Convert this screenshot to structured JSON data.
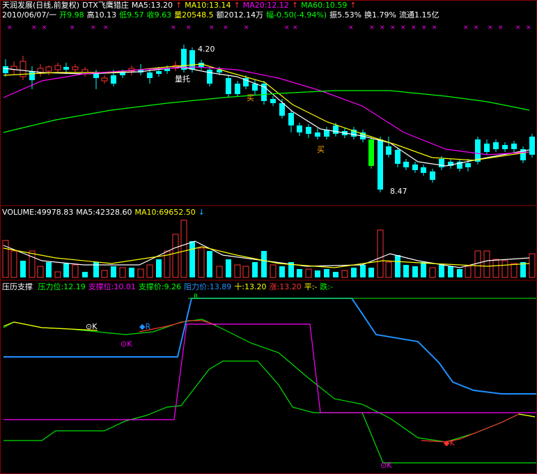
{
  "header": {
    "title": "天润发展(日线,前复权)",
    "indicator": "DTX飞鹰猎庄",
    "ma5": "MA5:13.20",
    "ma10": "MA10:13.14",
    "ma20": "MA20:12.12",
    "ma60": "MA60:10.59",
    "arrow": "↑"
  },
  "quote": {
    "date": "2010/06/07/一",
    "open": "开9.98",
    "high": "高10.13",
    "low": "低9.57",
    "close": "收9.63",
    "volume": "量20548.5",
    "amount": "额2012.14万",
    "change": "幅-0.50(-4.94%)",
    "amplitude": "振5.53%",
    "turnover": "换1.79%",
    "float": "流通1.15亿"
  },
  "price_annotations": {
    "high_label": "4.20",
    "low_label": "8.47",
    "volume_support": "量托",
    "buy1": "买",
    "buy2": "买"
  },
  "volume_panel": {
    "volume": "VOLUME:49978.83",
    "ma5": "MA5:42328.60",
    "ma10": "MA10:69652.50",
    "arrow": "↓"
  },
  "pressure_panel": {
    "title": "压历支撑",
    "pressure": "压力位:12.19",
    "support": "支撑位:10.01",
    "support_price": "支撑价:9.26",
    "resistance_price": "阻力价:13.89",
    "ten": "十:13.20",
    "up": "涨:13.20",
    "flat": "平:-",
    "down": "跌:-",
    "marker_k1": "K",
    "marker_r": "R",
    "marker_k2": "K",
    "marker_k3": "K",
    "marker_k4": "K",
    "marker_top": "R"
  },
  "colors": {
    "up_candle": "#ff3232",
    "down_candle": "#00ffff",
    "ma5": "#ffffff",
    "ma10": "#ffff00",
    "ma20": "#ff00ff",
    "ma60": "#00ff00",
    "grid": "#8b0000",
    "pressure_blue": "#1e90ff",
    "support_green": "#00e000"
  }
}
